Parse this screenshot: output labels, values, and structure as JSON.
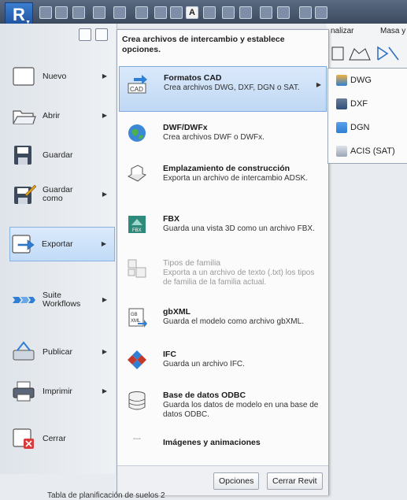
{
  "ribbon_tabs": [
    "nalizar",
    "Masa y"
  ],
  "left_menu": [
    {
      "label": "Nuevo",
      "has_submenu": true
    },
    {
      "label": "Abrir",
      "has_submenu": true
    },
    {
      "label": "Guardar",
      "has_submenu": false
    },
    {
      "label": "Guardar como",
      "has_submenu": true
    },
    {
      "label": "Exportar",
      "has_submenu": true,
      "active": true
    },
    {
      "label": "Suite Workflows",
      "has_submenu": true
    },
    {
      "label": "Publicar",
      "has_submenu": true
    },
    {
      "label": "Imprimir",
      "has_submenu": true
    },
    {
      "label": "Cerrar",
      "has_submenu": false
    }
  ],
  "flyout": {
    "header": "Crea archivos de intercambio y establece opciones.",
    "items": [
      {
        "title": "Formatos CAD",
        "desc": "Crea archivos DWG, DXF, DGN o SAT.",
        "icon": "cad-export-icon"
      },
      {
        "title": "DWF/DWFx",
        "desc": "Crea archivos DWF o DWFx.",
        "icon": "globe-icon"
      },
      {
        "title": "Emplazamiento de construcción",
        "desc": "Exporta un archivo de intercambio ADSK.",
        "icon": "building-site-icon"
      },
      {
        "title": "FBX",
        "desc": "Guarda una vista 3D como un archivo FBX.",
        "icon": "fbx-icon"
      },
      {
        "title": "Tipos de familia",
        "desc": "Exporta a un archivo de texto (.txt) los tipos de familia de la familia actual.",
        "icon": "family-types-icon"
      },
      {
        "title": "gbXML",
        "desc": "Guarda el modelo como archivo gbXML.",
        "icon": "gbxml-icon"
      },
      {
        "title": "IFC",
        "desc": "Guarda un archivo IFC.",
        "icon": "ifc-icon"
      },
      {
        "title": "Base de datos ODBC",
        "desc": "Guarda los datos de modelo en una base de datos ODBC.",
        "icon": "database-icon"
      },
      {
        "title": "Imágenes y animaciones",
        "desc": "",
        "icon": "film-icon"
      }
    ],
    "options_button": "Opciones",
    "close_button": "Cerrar Revit"
  },
  "submenu": {
    "items": [
      "DWG",
      "DXF",
      "DGN",
      "ACIS (SAT)"
    ]
  },
  "status_text": "Tabla de planificación de suelos 2",
  "colors": {
    "accent": "#3a7fd0",
    "highlight": "#c1dbf7"
  }
}
